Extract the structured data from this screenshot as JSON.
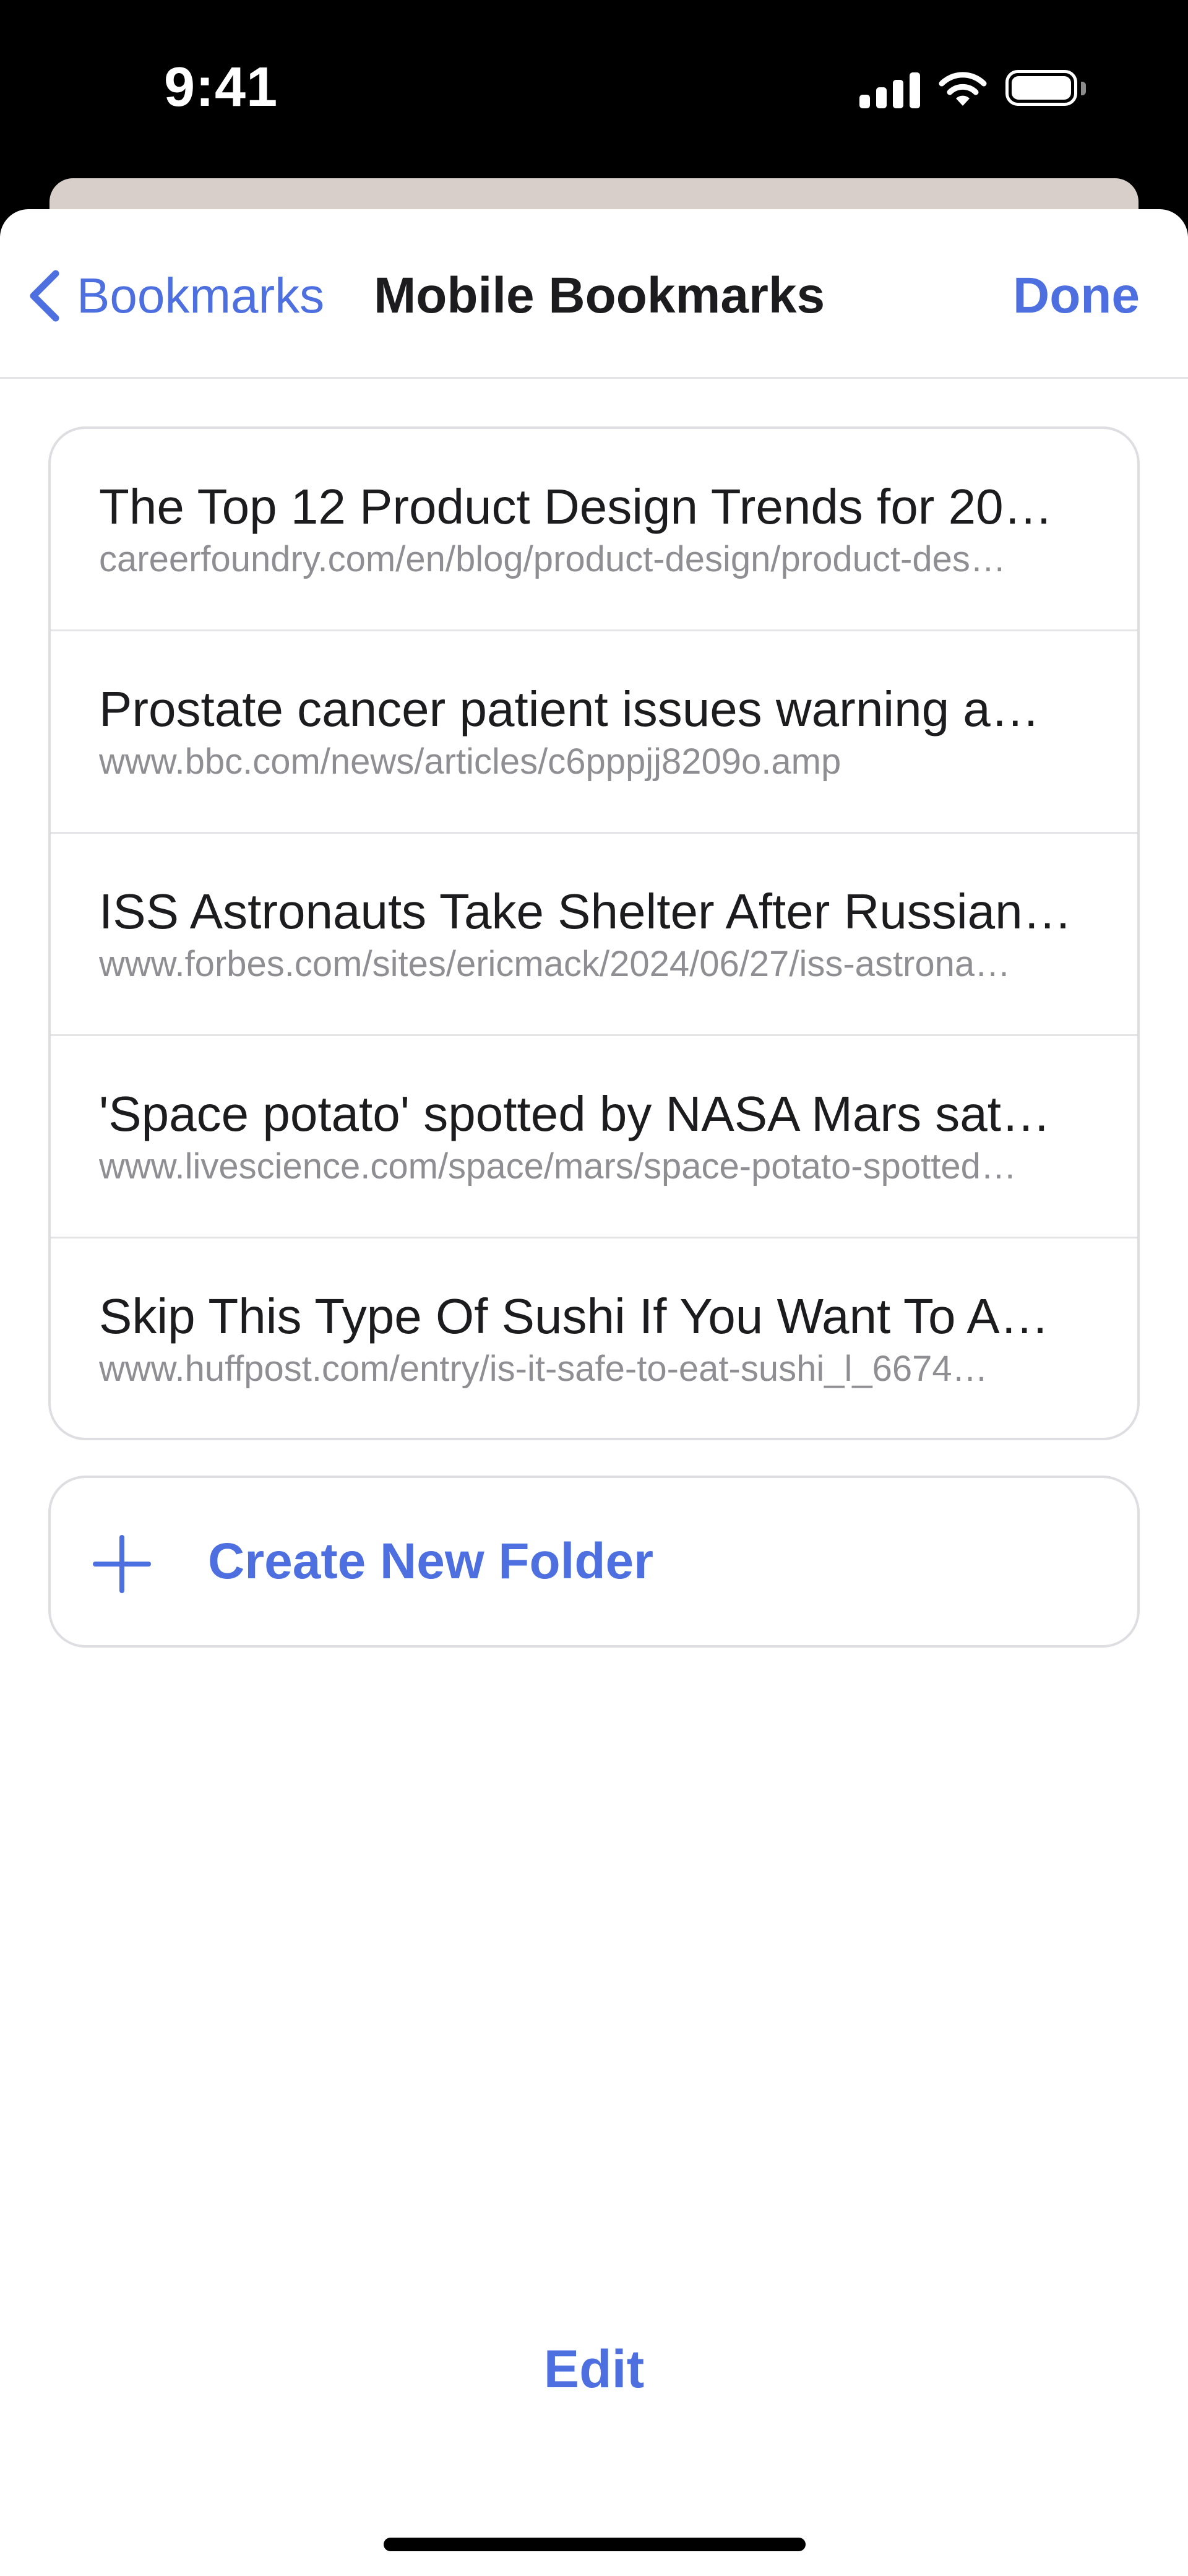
{
  "status_bar": {
    "time": "9:41",
    "icons": [
      "signal-icon",
      "wifi-icon",
      "battery-icon"
    ]
  },
  "nav": {
    "back_label": "Bookmarks",
    "title": "Mobile Bookmarks",
    "done_label": "Done"
  },
  "bookmarks": [
    {
      "title": "The Top 12 Product Design Trends for 20…",
      "url": "careerfoundry.com/en/blog/product-design/product-des…"
    },
    {
      "title": "Prostate cancer patient issues warning a…",
      "url": "www.bbc.com/news/articles/c6pppjj8209o.amp"
    },
    {
      "title": "ISS Astronauts Take Shelter After Russian…",
      "url": "www.forbes.com/sites/ericmack/2024/06/27/iss-astrona…"
    },
    {
      "title": "'Space potato' spotted by NASA Mars sat…",
      "url": "www.livescience.com/space/mars/space-potato-spotted…"
    },
    {
      "title": "Skip This Type Of Sushi If You Want To A…",
      "url": "www.huffpost.com/entry/is-it-safe-to-eat-sushi_l_6674…"
    }
  ],
  "create_folder": {
    "label": "Create New Folder"
  },
  "edit_label": "Edit",
  "colors": {
    "accent": "#4d6fe0",
    "primary_text": "#1c1c1e",
    "secondary_text": "#8e8e93",
    "separator": "#e4e4e7"
  }
}
